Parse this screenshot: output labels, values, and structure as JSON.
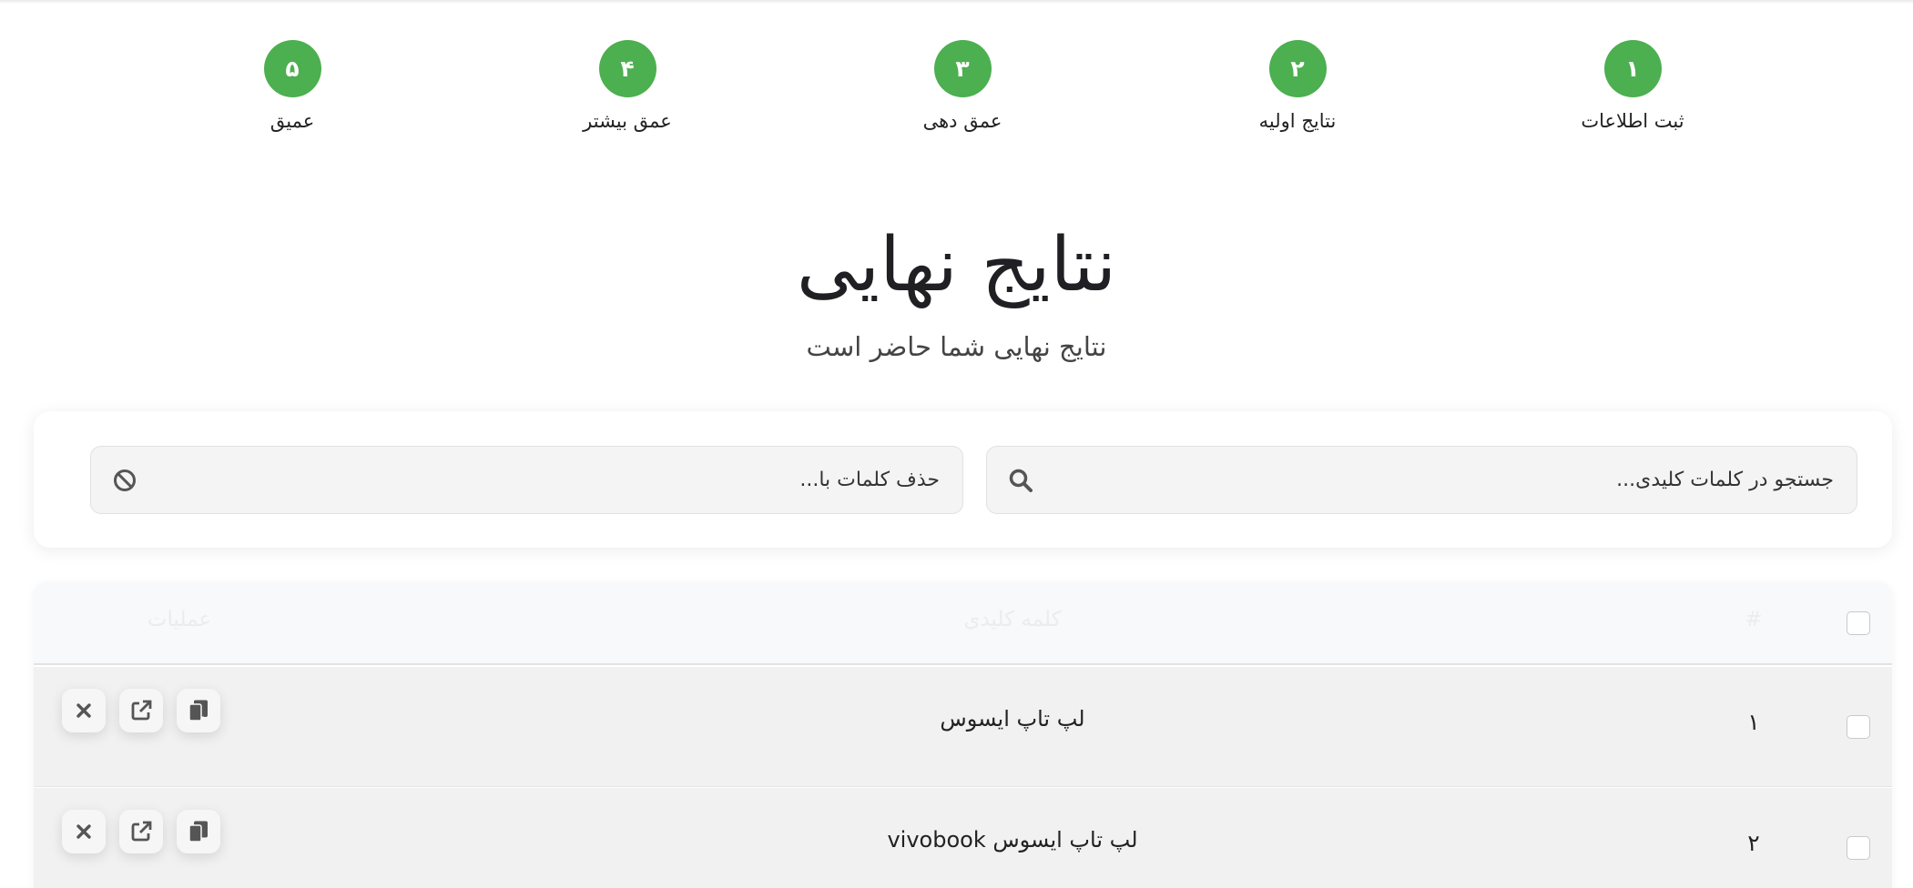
{
  "steps": [
    {
      "number": "۱",
      "label": "ثبت اطلاعات"
    },
    {
      "number": "۲",
      "label": "نتایج اولیه"
    },
    {
      "number": "۳",
      "label": "عمق دهی"
    },
    {
      "number": "۴",
      "label": "عمق بیشتر"
    },
    {
      "number": "۵",
      "label": "عمیق"
    }
  ],
  "header": {
    "title": "نتایج نهایی",
    "subtitle": "نتایج نهایی شما حاضر است"
  },
  "filters": {
    "search_placeholder": "جستجو در کلمات کلیدی...",
    "exclude_placeholder": "حذف کلمات با..."
  },
  "table": {
    "headers": {
      "index": "#",
      "keyword": "کلمه کلیدی",
      "actions": "عملیات"
    },
    "rows": [
      {
        "index": "۱",
        "keyword": "لپ تاپ ایسوس"
      },
      {
        "index": "۲",
        "keyword": "لپ تاپ ایسوس vivobook"
      }
    ]
  },
  "colors": {
    "step_accent": "#4caf50",
    "title": "#1f1f24",
    "row_bg": "#f1f1f1"
  },
  "icons": {
    "search": "search-icon",
    "exclude": "ban-icon",
    "copy": "copy-icon",
    "open": "external-link-icon",
    "delete": "close-icon"
  }
}
